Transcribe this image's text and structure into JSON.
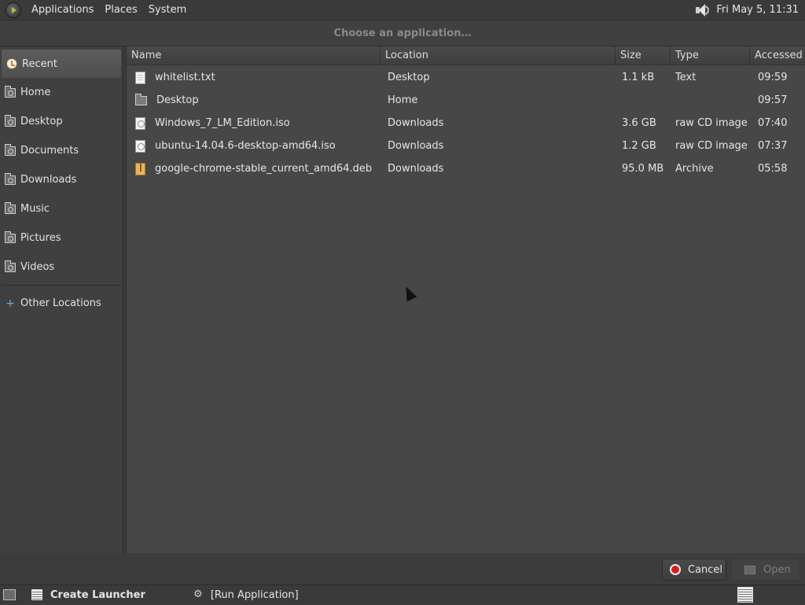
{
  "top_panel": {
    "menus": [
      "Applications",
      "Places",
      "System"
    ],
    "clock": "Fri May  5, 11:31"
  },
  "dialog": {
    "title": "Choose an application…"
  },
  "sidebar": {
    "items": [
      {
        "label": "Recent",
        "icon": "recent-icon"
      },
      {
        "label": "Home",
        "icon": "folder-icon"
      },
      {
        "label": "Desktop",
        "icon": "folder-icon"
      },
      {
        "label": "Documents",
        "icon": "folder-icon"
      },
      {
        "label": "Downloads",
        "icon": "folder-icon"
      },
      {
        "label": "Music",
        "icon": "folder-icon"
      },
      {
        "label": "Pictures",
        "icon": "folder-icon"
      },
      {
        "label": "Videos",
        "icon": "folder-icon"
      }
    ],
    "other_locations": "Other Locations"
  },
  "file_list": {
    "columns": [
      "Name",
      "Location",
      "Size",
      "Type",
      "Accessed"
    ],
    "rows": [
      {
        "name": "whitelist.txt",
        "location": "Desktop",
        "size": "1.1 kB",
        "type": "Text",
        "accessed": "09:59",
        "icon": "text-file-icon"
      },
      {
        "name": "Desktop",
        "location": "Home",
        "size": "",
        "type": "",
        "accessed": "09:57",
        "icon": "folder-icon"
      },
      {
        "name": "Windows_7_LM_Edition.iso",
        "location": "Downloads",
        "size": "3.6 GB",
        "type": "raw CD image",
        "accessed": "07:40",
        "icon": "disc-image-icon"
      },
      {
        "name": "ubuntu-14.04.6-desktop-amd64.iso",
        "location": "Downloads",
        "size": "1.2 GB",
        "type": "raw CD image",
        "accessed": "07:37",
        "icon": "disc-image-icon"
      },
      {
        "name": "google-chrome-stable_current_amd64.deb",
        "location": "Downloads",
        "size": "95.0 MB",
        "type": "Archive",
        "accessed": "05:58",
        "icon": "archive-icon"
      }
    ]
  },
  "buttons": {
    "cancel": "Cancel",
    "open": "Open"
  },
  "taskbar": {
    "tasks": [
      "Create Launcher",
      "[Run Application]"
    ]
  },
  "colors": {
    "background": "#3c3c3c",
    "cancel_red": "#e01a1a",
    "accent_green": "#9ccc3c"
  }
}
